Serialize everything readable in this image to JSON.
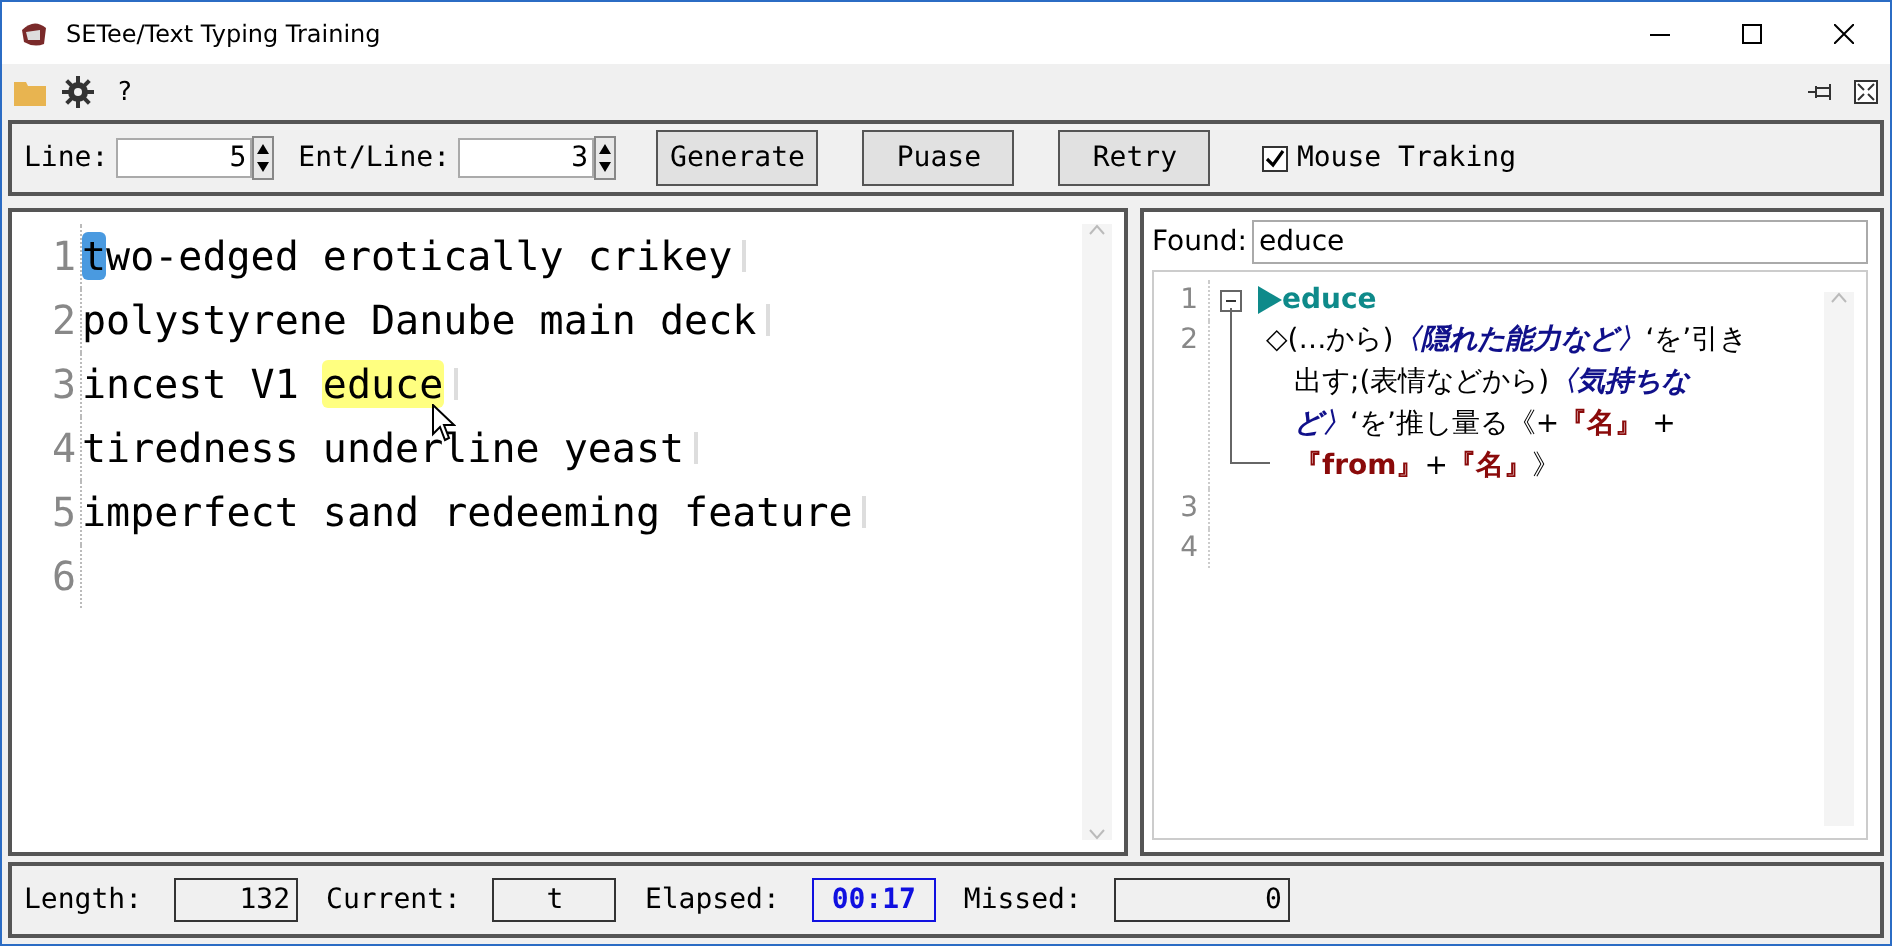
{
  "window": {
    "title": "SETee/Text Typing Training"
  },
  "toolbar": {
    "help": "?"
  },
  "options": {
    "line_label": "Line:",
    "line_value": "5",
    "ent_label": "Ent/Line:",
    "ent_value": "3",
    "buttons": [
      "Generate",
      "Puase",
      "Retry"
    ],
    "mouse_tracking": {
      "label": "Mouse Traking",
      "checked": true
    }
  },
  "editor": {
    "lines": [
      {
        "number": "1",
        "segments": [
          {
            "kind": "cursor",
            "text": "t"
          },
          {
            "kind": "plain",
            "text": "wo-edged erotically crikey"
          }
        ]
      },
      {
        "number": "2",
        "segments": [
          {
            "kind": "plain",
            "text": "polystyrene Danube main deck"
          }
        ]
      },
      {
        "number": "3",
        "segments": [
          {
            "kind": "plain",
            "text": "incest V1 "
          },
          {
            "kind": "highlight",
            "text": "educe"
          }
        ]
      },
      {
        "number": "4",
        "segments": [
          {
            "kind": "plain",
            "text": "tiredness underline yeast"
          }
        ]
      },
      {
        "number": "5",
        "segments": [
          {
            "kind": "plain",
            "text": "imperfect sand redeeming feature"
          }
        ]
      },
      {
        "number": "6"
      }
    ]
  },
  "dictionary": {
    "found_label": "Found:",
    "found_value": "educe",
    "expanded": true,
    "lines": [
      {
        "number": "1",
        "kind": "headword",
        "text": "educe"
      },
      {
        "number": "2",
        "kind": "definition",
        "segments": [
          {
            "kind": "plain",
            "text": "◇(…から)"
          },
          {
            "kind": "note",
            "text": "〈隠れた能力など〉"
          },
          {
            "kind": "plain",
            "text": "‘を’引き出す;(表情などから)"
          },
          {
            "kind": "note",
            "text": "〈気持ちなど〉"
          },
          {
            "kind": "plain",
            "text": "‘を’推し量る《+"
          },
          {
            "kind": "tag",
            "text": "『名』"
          },
          {
            "kind": "plain",
            "text": " +"
          },
          {
            "kind": "tag",
            "text": "『from』"
          },
          {
            "kind": "plain",
            "text": "+"
          },
          {
            "kind": "tag",
            "text": "『名』"
          },
          {
            "kind": "plain",
            "text": "》"
          }
        ]
      },
      {
        "number": "3",
        "kind": "blank"
      },
      {
        "number": "4",
        "kind": "blank"
      }
    ]
  },
  "status_bar": [
    {
      "label": "Length:",
      "value": "132",
      "kind": "right"
    },
    {
      "label": "Current:",
      "value": "t",
      "kind": "center"
    },
    {
      "label": "Elapsed:",
      "value": "00:17",
      "kind": "timer"
    },
    {
      "label": "Missed:",
      "value": "0",
      "kind": "right"
    }
  ]
}
